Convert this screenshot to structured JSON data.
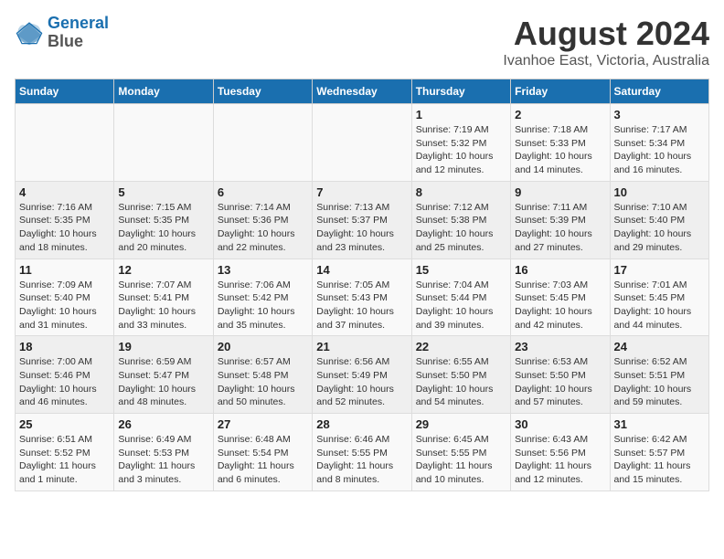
{
  "header": {
    "logo_line1": "General",
    "logo_line2": "Blue",
    "main_title": "August 2024",
    "subtitle": "Ivanhoe East, Victoria, Australia"
  },
  "days_of_week": [
    "Sunday",
    "Monday",
    "Tuesday",
    "Wednesday",
    "Thursday",
    "Friday",
    "Saturday"
  ],
  "weeks": [
    [
      {
        "day": "",
        "info": ""
      },
      {
        "day": "",
        "info": ""
      },
      {
        "day": "",
        "info": ""
      },
      {
        "day": "",
        "info": ""
      },
      {
        "day": "1",
        "info": "Sunrise: 7:19 AM\nSunset: 5:32 PM\nDaylight: 10 hours\nand 12 minutes."
      },
      {
        "day": "2",
        "info": "Sunrise: 7:18 AM\nSunset: 5:33 PM\nDaylight: 10 hours\nand 14 minutes."
      },
      {
        "day": "3",
        "info": "Sunrise: 7:17 AM\nSunset: 5:34 PM\nDaylight: 10 hours\nand 16 minutes."
      }
    ],
    [
      {
        "day": "4",
        "info": "Sunrise: 7:16 AM\nSunset: 5:35 PM\nDaylight: 10 hours\nand 18 minutes."
      },
      {
        "day": "5",
        "info": "Sunrise: 7:15 AM\nSunset: 5:35 PM\nDaylight: 10 hours\nand 20 minutes."
      },
      {
        "day": "6",
        "info": "Sunrise: 7:14 AM\nSunset: 5:36 PM\nDaylight: 10 hours\nand 22 minutes."
      },
      {
        "day": "7",
        "info": "Sunrise: 7:13 AM\nSunset: 5:37 PM\nDaylight: 10 hours\nand 23 minutes."
      },
      {
        "day": "8",
        "info": "Sunrise: 7:12 AM\nSunset: 5:38 PM\nDaylight: 10 hours\nand 25 minutes."
      },
      {
        "day": "9",
        "info": "Sunrise: 7:11 AM\nSunset: 5:39 PM\nDaylight: 10 hours\nand 27 minutes."
      },
      {
        "day": "10",
        "info": "Sunrise: 7:10 AM\nSunset: 5:40 PM\nDaylight: 10 hours\nand 29 minutes."
      }
    ],
    [
      {
        "day": "11",
        "info": "Sunrise: 7:09 AM\nSunset: 5:40 PM\nDaylight: 10 hours\nand 31 minutes."
      },
      {
        "day": "12",
        "info": "Sunrise: 7:07 AM\nSunset: 5:41 PM\nDaylight: 10 hours\nand 33 minutes."
      },
      {
        "day": "13",
        "info": "Sunrise: 7:06 AM\nSunset: 5:42 PM\nDaylight: 10 hours\nand 35 minutes."
      },
      {
        "day": "14",
        "info": "Sunrise: 7:05 AM\nSunset: 5:43 PM\nDaylight: 10 hours\nand 37 minutes."
      },
      {
        "day": "15",
        "info": "Sunrise: 7:04 AM\nSunset: 5:44 PM\nDaylight: 10 hours\nand 39 minutes."
      },
      {
        "day": "16",
        "info": "Sunrise: 7:03 AM\nSunset: 5:45 PM\nDaylight: 10 hours\nand 42 minutes."
      },
      {
        "day": "17",
        "info": "Sunrise: 7:01 AM\nSunset: 5:45 PM\nDaylight: 10 hours\nand 44 minutes."
      }
    ],
    [
      {
        "day": "18",
        "info": "Sunrise: 7:00 AM\nSunset: 5:46 PM\nDaylight: 10 hours\nand 46 minutes."
      },
      {
        "day": "19",
        "info": "Sunrise: 6:59 AM\nSunset: 5:47 PM\nDaylight: 10 hours\nand 48 minutes."
      },
      {
        "day": "20",
        "info": "Sunrise: 6:57 AM\nSunset: 5:48 PM\nDaylight: 10 hours\nand 50 minutes."
      },
      {
        "day": "21",
        "info": "Sunrise: 6:56 AM\nSunset: 5:49 PM\nDaylight: 10 hours\nand 52 minutes."
      },
      {
        "day": "22",
        "info": "Sunrise: 6:55 AM\nSunset: 5:50 PM\nDaylight: 10 hours\nand 54 minutes."
      },
      {
        "day": "23",
        "info": "Sunrise: 6:53 AM\nSunset: 5:50 PM\nDaylight: 10 hours\nand 57 minutes."
      },
      {
        "day": "24",
        "info": "Sunrise: 6:52 AM\nSunset: 5:51 PM\nDaylight: 10 hours\nand 59 minutes."
      }
    ],
    [
      {
        "day": "25",
        "info": "Sunrise: 6:51 AM\nSunset: 5:52 PM\nDaylight: 11 hours\nand 1 minute."
      },
      {
        "day": "26",
        "info": "Sunrise: 6:49 AM\nSunset: 5:53 PM\nDaylight: 11 hours\nand 3 minutes."
      },
      {
        "day": "27",
        "info": "Sunrise: 6:48 AM\nSunset: 5:54 PM\nDaylight: 11 hours\nand 6 minutes."
      },
      {
        "day": "28",
        "info": "Sunrise: 6:46 AM\nSunset: 5:55 PM\nDaylight: 11 hours\nand 8 minutes."
      },
      {
        "day": "29",
        "info": "Sunrise: 6:45 AM\nSunset: 5:55 PM\nDaylight: 11 hours\nand 10 minutes."
      },
      {
        "day": "30",
        "info": "Sunrise: 6:43 AM\nSunset: 5:56 PM\nDaylight: 11 hours\nand 12 minutes."
      },
      {
        "day": "31",
        "info": "Sunrise: 6:42 AM\nSunset: 5:57 PM\nDaylight: 11 hours\nand 15 minutes."
      }
    ]
  ]
}
